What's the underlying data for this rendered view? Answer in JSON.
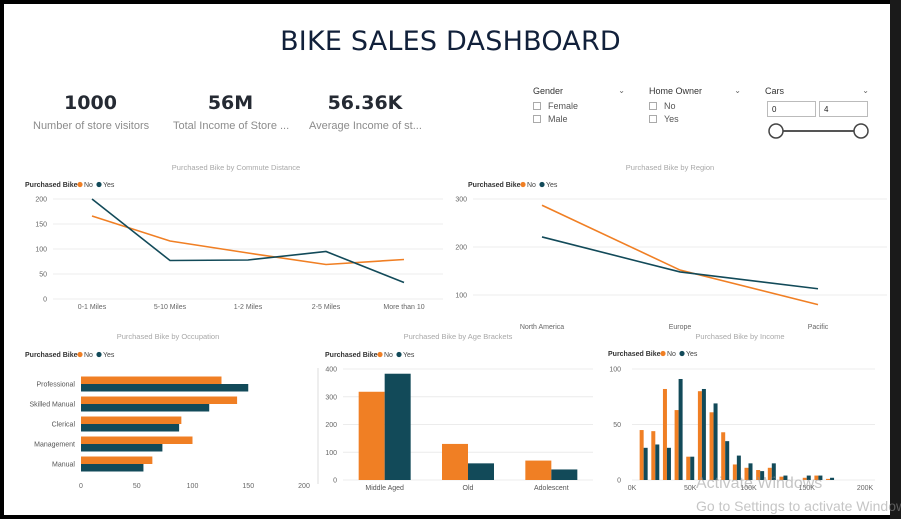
{
  "dashboard": {
    "title": "BIKE SALES DASHBOARD"
  },
  "kpis": [
    {
      "value": "1000",
      "label": "Number of store visitors"
    },
    {
      "value": "56M",
      "label": "Total Income of Store ..."
    },
    {
      "value": "56.36K",
      "label": "Average Income of st..."
    }
  ],
  "filters": {
    "gender": {
      "label": "Gender",
      "options": [
        "Female",
        "Male"
      ]
    },
    "home_owner": {
      "label": "Home Owner",
      "options": [
        "No",
        "Yes"
      ]
    },
    "cars": {
      "label": "Cars",
      "min": "0",
      "max": "4"
    }
  },
  "legend_label": "Purchased Bike",
  "colors": {
    "no": "#f07f24",
    "yes": "#124a59",
    "title": "#11203a"
  },
  "chart_data": [
    {
      "id": "commute",
      "type": "line",
      "title": "Purchased Bike by Commute Distance",
      "categories": [
        "0-1 Miles",
        "5-10 Miles",
        "1-2 Miles",
        "2-5 Miles",
        "More than 10"
      ],
      "series": [
        {
          "name": "No",
          "values": [
            166,
            116,
            92,
            69,
            79
          ]
        },
        {
          "name": "Yes",
          "values": [
            200,
            77,
            78,
            95,
            33
          ]
        }
      ],
      "ylim": [
        0,
        200
      ],
      "yticks": [
        0,
        50,
        100,
        150,
        200
      ],
      "grid": true,
      "legend": "top-left"
    },
    {
      "id": "region",
      "type": "line",
      "title": "Purchased Bike by Region",
      "categories": [
        "North America",
        "Europe",
        "Pacific"
      ],
      "series": [
        {
          "name": "No",
          "values": [
            287,
            152,
            80
          ]
        },
        {
          "name": "Yes",
          "values": [
            221,
            148,
            113
          ]
        }
      ],
      "ylim": [
        50,
        300
      ],
      "yticks": [
        100,
        200,
        300
      ],
      "grid": true,
      "legend": "top-left"
    },
    {
      "id": "occupation",
      "type": "bar",
      "orientation": "horizontal",
      "title": "Purchased Bike by Occupation",
      "categories": [
        "Professional",
        "Skilled Manual",
        "Clerical",
        "Management",
        "Manual"
      ],
      "series": [
        {
          "name": "No",
          "values": [
            126,
            140,
            90,
            100,
            64
          ]
        },
        {
          "name": "Yes",
          "values": [
            150,
            115,
            88,
            73,
            56
          ]
        }
      ],
      "xlim": [
        0,
        200
      ],
      "xticks": [
        0,
        50,
        100,
        150,
        200
      ],
      "legend": "top-left"
    },
    {
      "id": "age",
      "type": "bar",
      "title": "Purchased Bike by Age Brackets",
      "categories": [
        "Middle Aged",
        "Old",
        "Adolescent"
      ],
      "series": [
        {
          "name": "No",
          "values": [
            318,
            130,
            70
          ]
        },
        {
          "name": "Yes",
          "values": [
            383,
            60,
            38
          ]
        }
      ],
      "ylim": [
        0,
        400
      ],
      "yticks": [
        0,
        100,
        200,
        300,
        400
      ],
      "grid": true,
      "legend": "top-left"
    },
    {
      "id": "income",
      "type": "bar",
      "title": "Purchased Bike by Income",
      "x": [
        10000,
        20000,
        30000,
        40000,
        50000,
        60000,
        70000,
        80000,
        90000,
        100000,
        110000,
        120000,
        130000,
        150000,
        160000,
        170000
      ],
      "series": [
        {
          "name": "No",
          "values": [
            45,
            44,
            82,
            63,
            21,
            80,
            61,
            43,
            14,
            11,
            9,
            11,
            3,
            2,
            4,
            1
          ]
        },
        {
          "name": "Yes",
          "values": [
            29,
            32,
            29,
            91,
            21,
            82,
            69,
            35,
            22,
            15,
            8,
            15,
            4,
            4,
            4,
            2
          ]
        }
      ],
      "xticklabels": [
        "0K",
        "50K",
        "100K",
        "150K",
        "200K"
      ],
      "xticks": [
        0,
        50000,
        100000,
        150000,
        200000
      ],
      "xlim": [
        0,
        200000
      ],
      "ylim": [
        0,
        100
      ],
      "yticks": [
        0,
        50,
        100
      ],
      "grid": true,
      "legend": "top-left"
    }
  ],
  "watermark": {
    "line1": "Activate Windows",
    "line2": "Go to Settings to activate Windows."
  }
}
